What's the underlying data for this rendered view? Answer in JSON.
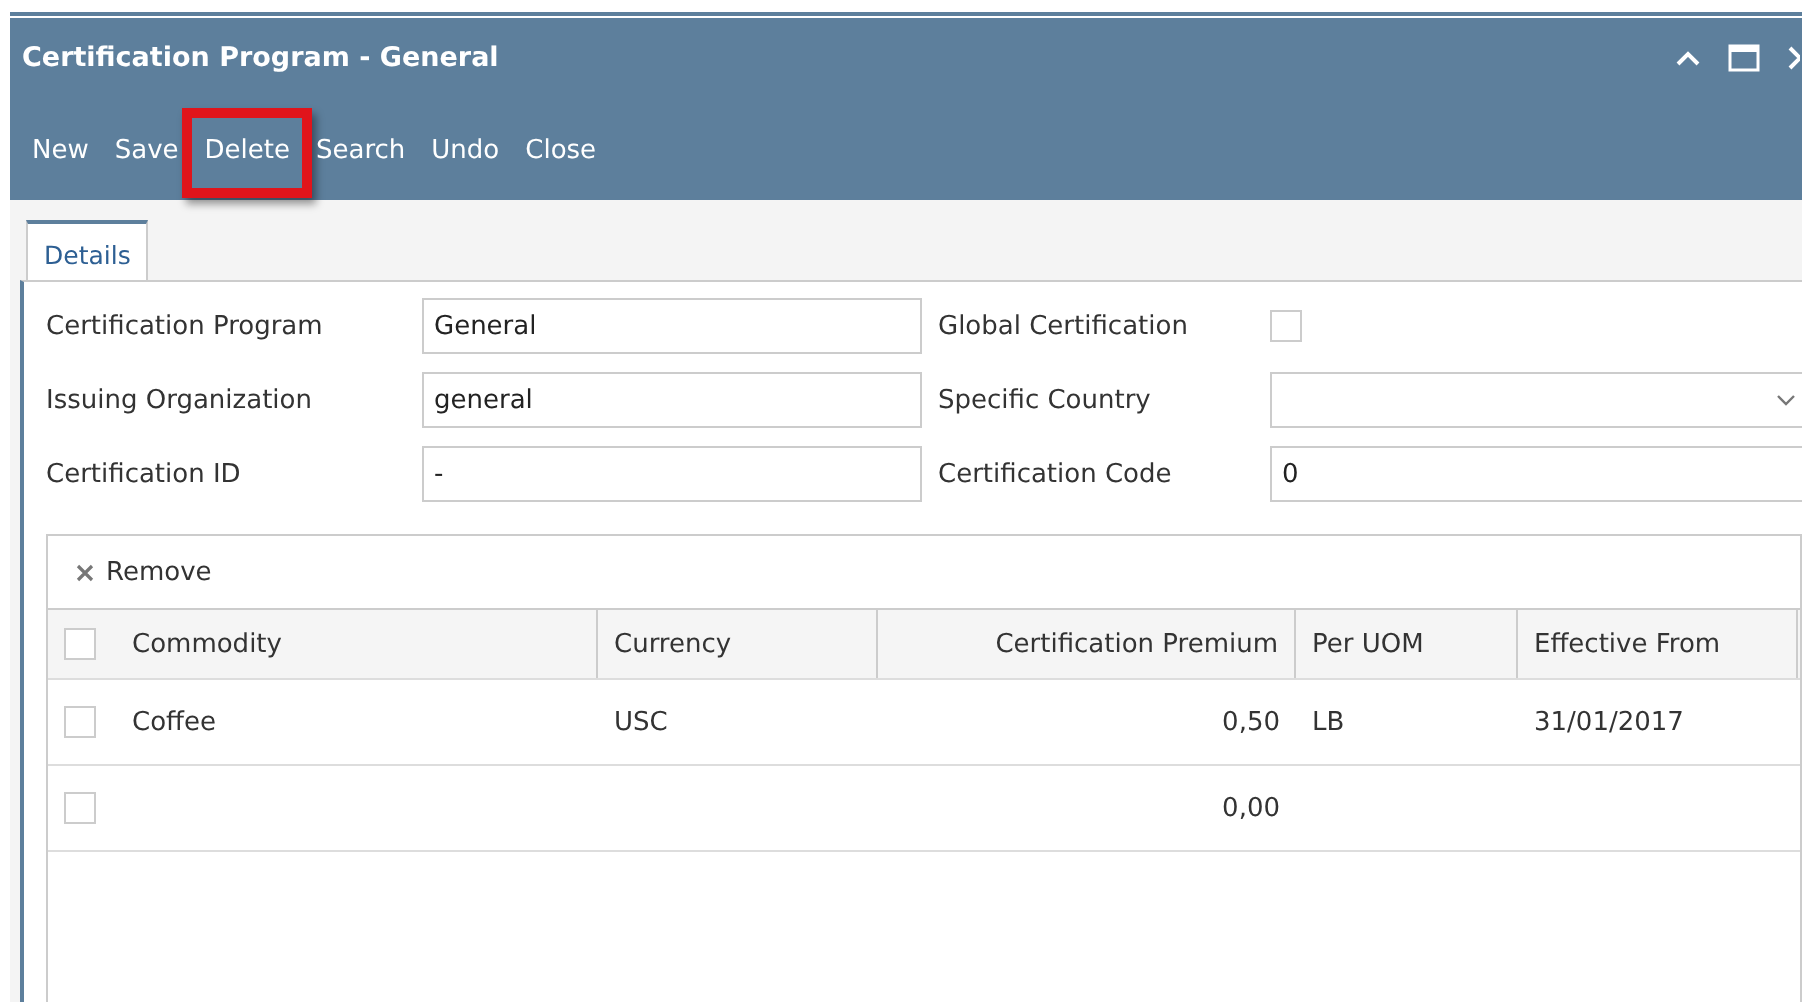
{
  "window": {
    "title": "Certification Program - General"
  },
  "toolbar": [
    {
      "label": "New",
      "highlighted": false
    },
    {
      "label": "Save",
      "highlighted": false
    },
    {
      "label": "Delete",
      "highlighted": true
    },
    {
      "label": "Search",
      "highlighted": false
    },
    {
      "label": "Undo",
      "highlighted": false
    },
    {
      "label": "Close",
      "highlighted": false
    }
  ],
  "tabs": [
    {
      "label": "Details",
      "selected": true
    }
  ],
  "form": {
    "left": [
      {
        "label": "Certification Program",
        "value": "General"
      },
      {
        "label": "Issuing Organization",
        "value": "general"
      },
      {
        "label": "Certification ID",
        "value": "-"
      }
    ],
    "right": [
      {
        "kind": "checkbox",
        "label": "Global Certification",
        "checked": false
      },
      {
        "kind": "dropdown",
        "label": "Specific Country"
      },
      {
        "kind": "text",
        "label": "Certification Code",
        "value": "0"
      }
    ]
  },
  "grid": {
    "remove_label": "Remove",
    "header_checked": false,
    "columns": [
      "Commodity",
      "Currency",
      "Certification Premium",
      "Per UOM",
      "Effective From"
    ],
    "rows": [
      {
        "checked": false,
        "cells": [
          "Coffee",
          "USC",
          "0,50",
          "LB",
          "31/01/2017"
        ]
      },
      {
        "checked": false,
        "cells": [
          "",
          "",
          "0,00",
          "",
          ""
        ]
      }
    ]
  }
}
